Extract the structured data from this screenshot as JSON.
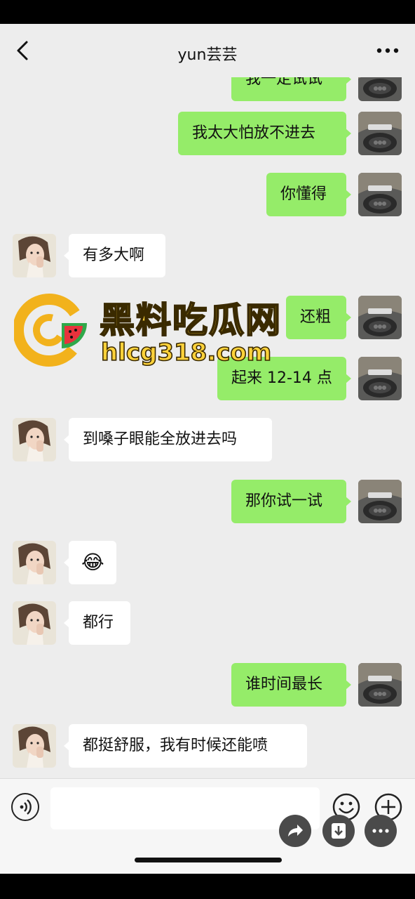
{
  "header": {
    "title": "yun芸芸"
  },
  "messages": [
    {
      "sender": "me",
      "text": "我一定试试"
    },
    {
      "sender": "me",
      "text": "我太大怕放不进去"
    },
    {
      "sender": "me",
      "text": "你懂得"
    },
    {
      "sender": "them",
      "text": "有多大啊"
    },
    {
      "sender": "me",
      "text": "还粗"
    },
    {
      "sender": "me",
      "text": "起来 12-14 点"
    },
    {
      "sender": "them",
      "text": "到嗓子眼能全放进去吗"
    },
    {
      "sender": "me",
      "text": "那你试一试"
    },
    {
      "sender": "them",
      "text": "😂"
    },
    {
      "sender": "them",
      "text": "都行"
    },
    {
      "sender": "me",
      "text": "谁时间最长"
    },
    {
      "sender": "them",
      "text": "都挺舒服，我有时候还能喷"
    }
  ],
  "watermark": {
    "title": "黑料吃瓜网",
    "url": "hlcg318.com"
  },
  "colors": {
    "me_bubble": "#95ec69",
    "them_bubble": "#ffffff",
    "background": "#ededed",
    "watermark": "#ffd23a"
  },
  "icons": {
    "back": "chevron-left-icon",
    "more": "more-dots-icon",
    "voice": "voice-icon",
    "emoji": "emoji-icon",
    "plus": "plus-icon",
    "share": "share-icon",
    "download": "download-icon",
    "menu": "more-dots-icon"
  }
}
